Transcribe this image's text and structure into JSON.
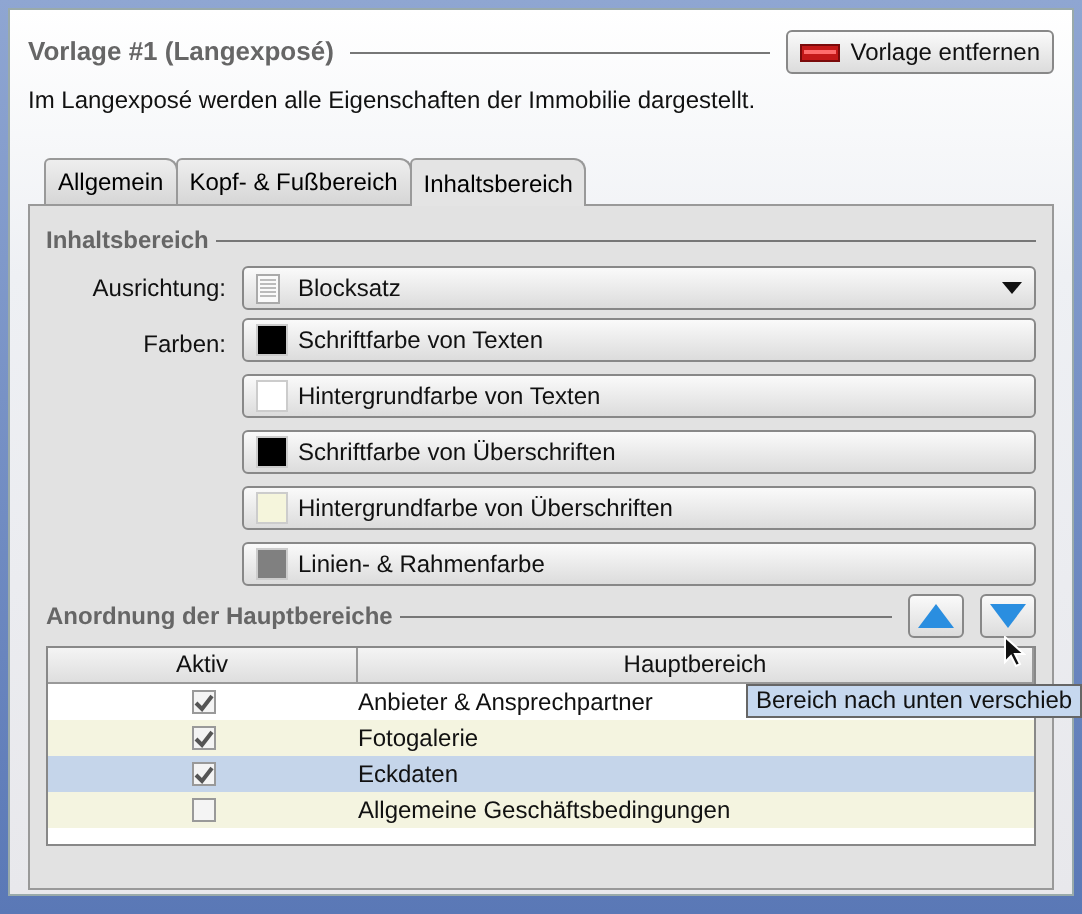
{
  "panel": {
    "title": "Vorlage #1 (Langexposé)",
    "remove_button": "Vorlage entfernen",
    "description": "Im Langexposé werden alle Eigenschaften der Immobilie dargestellt."
  },
  "tabs": [
    {
      "label": "Allgemein",
      "selected": false
    },
    {
      "label": "Kopf- & Fußbereich",
      "selected": false
    },
    {
      "label": "Inhaltsbereich",
      "selected": true
    }
  ],
  "content_section": {
    "title": "Inhaltsbereich",
    "alignment_label": "Ausrichtung:",
    "alignment_value": "Blocksatz",
    "colors_label": "Farben:",
    "color_buttons": [
      {
        "label": "Schriftfarbe von Texten",
        "color": "#000000"
      },
      {
        "label": "Hintergrundfarbe von Texten",
        "color": "#ffffff"
      },
      {
        "label": "Schriftfarbe von Überschriften",
        "color": "#000000"
      },
      {
        "label": "Hintergrundfarbe von Überschriften",
        "color": "#f5f5dc"
      },
      {
        "label": "Linien- & Rahmenfarbe",
        "color": "#808080"
      }
    ]
  },
  "order_section": {
    "title": "Anordnung der Hauptbereiche",
    "table": {
      "columns": [
        "Aktiv",
        "Hauptbereich"
      ],
      "rows": [
        {
          "name": "Anbieter & Ansprechpartner",
          "checked": true,
          "selected": false
        },
        {
          "name": "Fotogalerie",
          "checked": true,
          "selected": false
        },
        {
          "name": "Eckdaten",
          "checked": true,
          "selected": true
        },
        {
          "name": "Allgemeine Geschäftsbedingungen",
          "checked": false,
          "selected": false
        }
      ]
    }
  },
  "tooltip": "Bereich nach unten verschieb"
}
